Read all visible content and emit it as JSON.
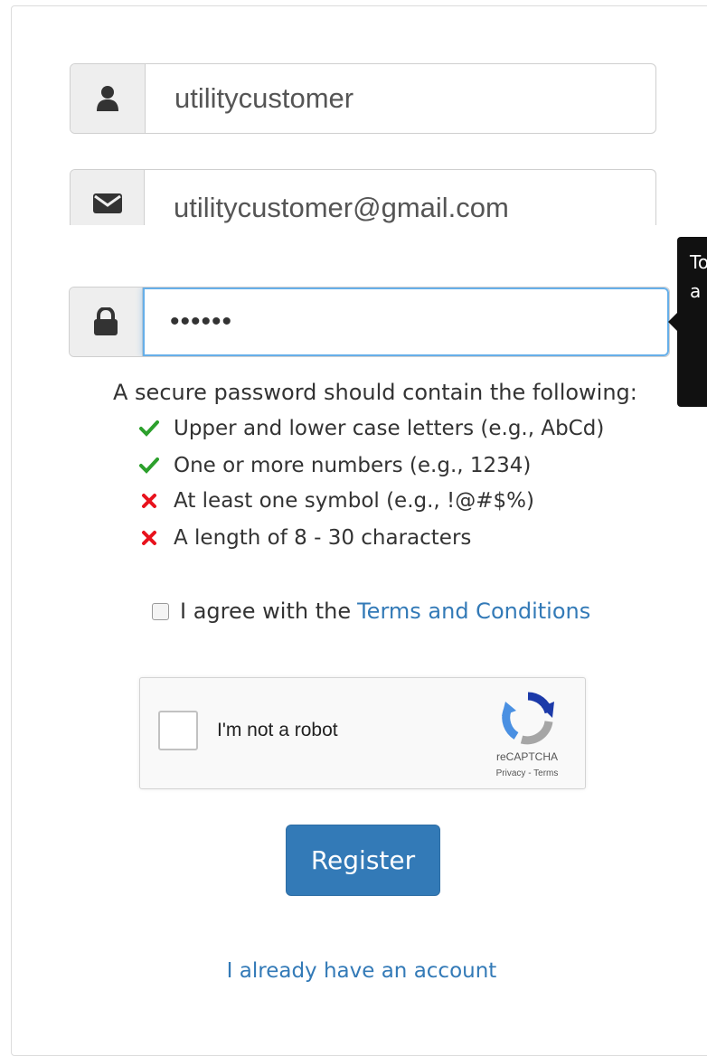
{
  "form": {
    "username": {
      "value": "utilitycustomer",
      "icon": "user-icon"
    },
    "email": {
      "value": "utilitycustomer@gmail.com",
      "icon": "envelope-icon"
    },
    "password": {
      "value": "••••••",
      "icon": "lock-icon"
    }
  },
  "tooltip": {
    "line1": "To",
    "line2": "a"
  },
  "password_rules": {
    "title": "A secure password should contain the following:",
    "items": [
      {
        "label": "Upper and lower case letters (e.g., AbCd)",
        "status": "met",
        "icon": "check-icon"
      },
      {
        "label": "One or more numbers (e.g., 1234)",
        "status": "met",
        "icon": "check-icon"
      },
      {
        "label": "At least one symbol (e.g., !@#$%)",
        "status": "unmet",
        "icon": "cross-icon"
      },
      {
        "label": "A length of 8 - 30 characters",
        "status": "unmet",
        "icon": "cross-icon"
      }
    ]
  },
  "terms": {
    "prefix": "I agree with the",
    "link": "Terms and Conditions",
    "checked": false
  },
  "recaptcha": {
    "label": "I'm not a robot",
    "brand": "reCAPTCHA",
    "links": "Privacy - Terms"
  },
  "register_label": "Register",
  "login_link": "I already have an account",
  "colors": {
    "primary": "#337ab7",
    "met": "#2ca02c",
    "unmet": "#e8121d",
    "focus": "#66afe9"
  }
}
